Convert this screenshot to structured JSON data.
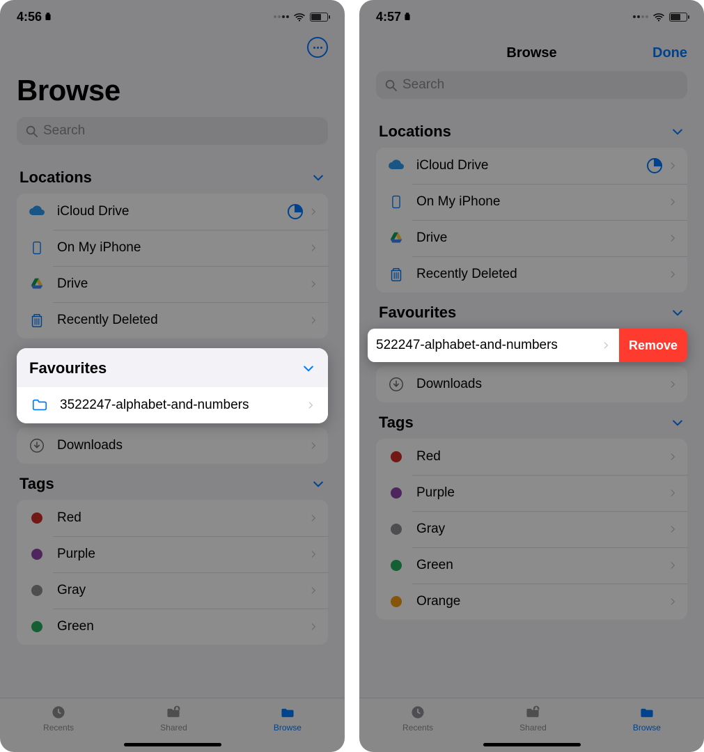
{
  "left": {
    "status": {
      "time": "4:56"
    },
    "title": "Browse",
    "search_placeholder": "Search",
    "sections": {
      "locations": {
        "header": "Locations",
        "items": [
          {
            "label": "iCloud Drive",
            "icon": "cloud",
            "hasPie": true
          },
          {
            "label": "On My iPhone",
            "icon": "iphone"
          },
          {
            "label": "Drive",
            "icon": "gdrive"
          },
          {
            "label": "Recently Deleted",
            "icon": "trash"
          }
        ]
      },
      "favourites": {
        "header": "Favourites",
        "items": [
          {
            "label": "3522247-alphabet-and-numbers",
            "icon": "folder"
          }
        ]
      },
      "downloads_label": "Downloads",
      "tags": {
        "header": "Tags",
        "items": [
          {
            "label": "Red",
            "color": "#d22f27"
          },
          {
            "label": "Purple",
            "color": "#8e44ad"
          },
          {
            "label": "Gray",
            "color": "#8e8e93"
          },
          {
            "label": "Green",
            "color": "#27ae60"
          }
        ]
      }
    },
    "tabs": {
      "recents": "Recents",
      "shared": "Shared",
      "browse": "Browse"
    }
  },
  "right": {
    "status": {
      "time": "4:57"
    },
    "title": "Browse",
    "done": "Done",
    "search_placeholder": "Search",
    "sections": {
      "locations": {
        "header": "Locations",
        "items": [
          {
            "label": "iCloud Drive",
            "icon": "cloud",
            "hasPie": true
          },
          {
            "label": "On My iPhone",
            "icon": "iphone"
          },
          {
            "label": "Drive",
            "icon": "gdrive"
          },
          {
            "label": "Recently Deleted",
            "icon": "trash"
          }
        ]
      },
      "favourites": {
        "header": "Favourites",
        "swiped_label": "522247-alphabet-and-numbers",
        "remove_label": "Remove",
        "downloads_label": "Downloads"
      },
      "tags": {
        "header": "Tags",
        "items": [
          {
            "label": "Red",
            "color": "#d22f27"
          },
          {
            "label": "Purple",
            "color": "#8e44ad"
          },
          {
            "label": "Gray",
            "color": "#8e8e93"
          },
          {
            "label": "Green",
            "color": "#27ae60"
          },
          {
            "label": "Orange",
            "color": "#f39c12"
          }
        ]
      }
    },
    "tabs": {
      "recents": "Recents",
      "shared": "Shared",
      "browse": "Browse"
    }
  }
}
